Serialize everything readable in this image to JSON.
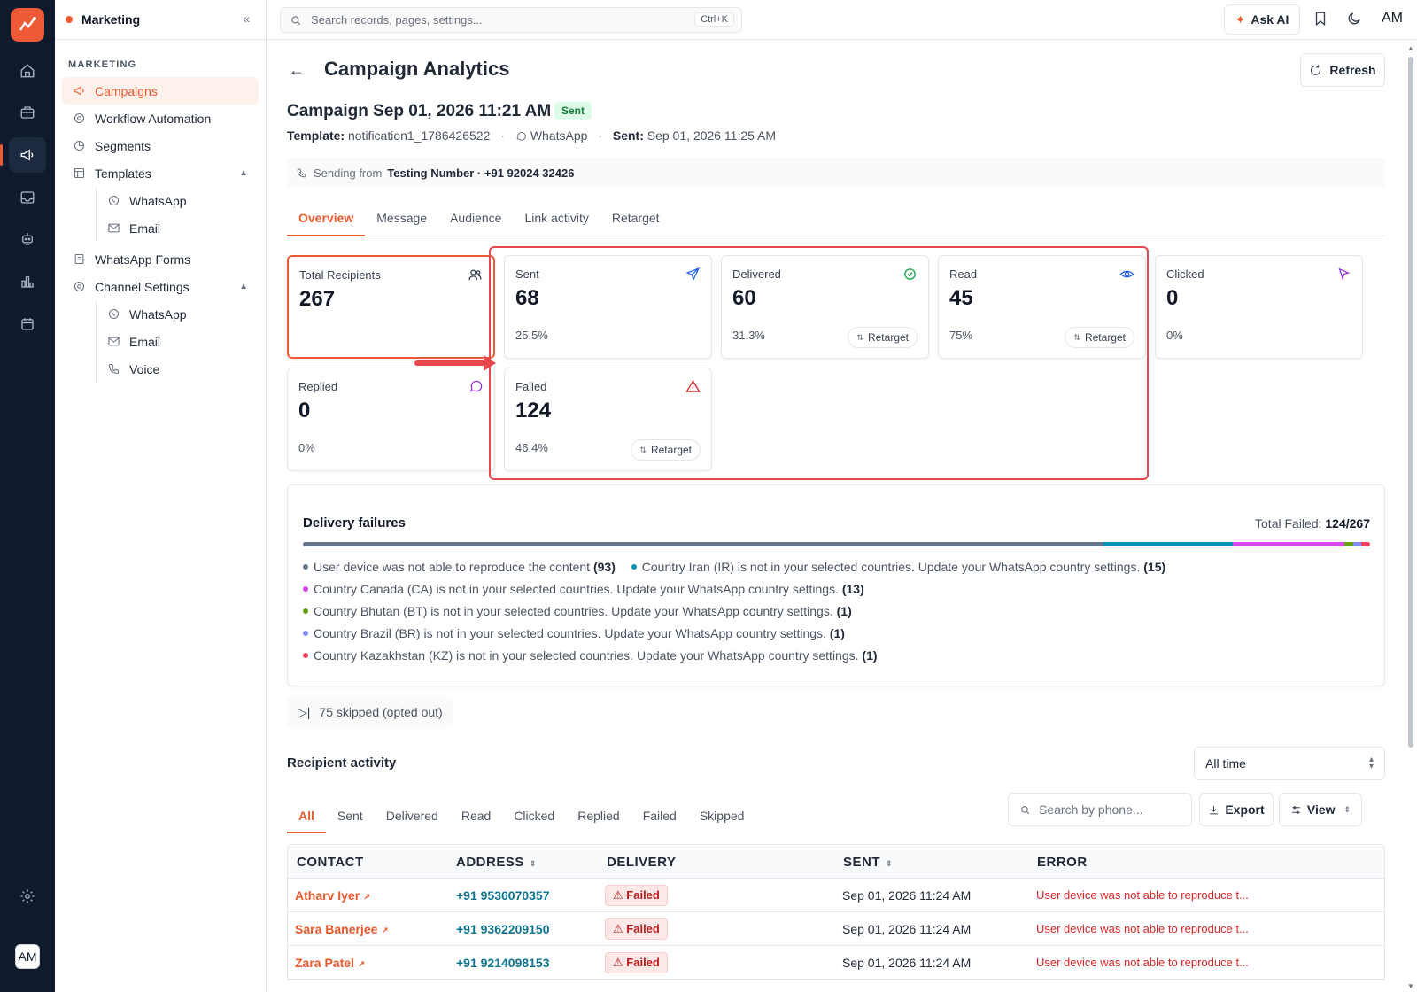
{
  "rail": {
    "logo_text": "",
    "icons": [
      "home-icon",
      "briefcase-icon",
      "megaphone-icon",
      "inbox-icon",
      "robot-icon",
      "bar-chart-icon",
      "calendar-icon"
    ],
    "settings_icon": "gear-icon",
    "avatar": "AM"
  },
  "sidebar": {
    "title": "Marketing",
    "collapse_icon": "«",
    "section": "MARKETING",
    "items": [
      {
        "label": "Campaigns",
        "icon": "megaphone-icon",
        "active": true
      },
      {
        "label": "Workflow Automation",
        "icon": "gear-icon"
      },
      {
        "label": "Segments",
        "icon": "pie-chart-icon"
      },
      {
        "label": "Templates",
        "icon": "template-icon",
        "expanded": true
      },
      {
        "label": "WhatsApp Forms",
        "icon": "form-icon"
      },
      {
        "label": "Channel Settings",
        "icon": "gear-icon",
        "expanded": true
      }
    ],
    "template_children": [
      "WhatsApp",
      "Email"
    ],
    "channel_children": [
      "WhatsApp",
      "Email",
      "Voice"
    ]
  },
  "topbar": {
    "search_placeholder": "Search records, pages, settings...",
    "shortcut": "Ctrl+K",
    "ask_ai": "Ask AI",
    "avatar": "AM"
  },
  "page": {
    "title": "Campaign Analytics",
    "refresh": "Refresh",
    "campaign_title": "Campaign Sep 01, 2026 11:21 AM",
    "status": "Sent",
    "template_label": "Template:",
    "template_value": "notification1_1786426522",
    "channel": "WhatsApp",
    "sent_label": "Sent:",
    "sent_value": "Sep 01, 2026 11:25 AM",
    "sending_from_label": "Sending from",
    "sending_from_value": "Testing Number · +91 92024 32426",
    "tabs": [
      "Overview",
      "Message",
      "Audience",
      "Link activity",
      "Retarget"
    ]
  },
  "stats": {
    "total": {
      "label": "Total Recipients",
      "value": "267"
    },
    "sent": {
      "label": "Sent",
      "value": "68",
      "pct": "25.5%"
    },
    "delivered": {
      "label": "Delivered",
      "value": "60",
      "pct": "31.3%",
      "action": "Retarget"
    },
    "read": {
      "label": "Read",
      "value": "45",
      "pct": "75%",
      "action": "Retarget"
    },
    "clicked": {
      "label": "Clicked",
      "value": "0",
      "pct": "0%"
    },
    "replied": {
      "label": "Replied",
      "value": "0",
      "pct": "0%"
    },
    "failed": {
      "label": "Failed",
      "value": "124",
      "pct": "46.4%",
      "action": "Retarget"
    }
  },
  "failures": {
    "title": "Delivery failures",
    "total_label": "Total Failed:",
    "total_value": "124/267",
    "items": [
      {
        "text": "User device was not able to reproduce the content",
        "count": "(93)",
        "value": 93,
        "color": "#64748b"
      },
      {
        "text": "Country Iran (IR) is not in your selected countries. Update your WhatsApp country settings.",
        "count": "(15)",
        "value": 15,
        "color": "#0891b2"
      },
      {
        "text": "Country Canada (CA) is not in your selected countries. Update your WhatsApp country settings.",
        "count": "(13)",
        "value": 13,
        "color": "#d946ef"
      },
      {
        "text": "Country Bhutan (BT) is not in your selected countries. Update your WhatsApp country settings.",
        "count": "(1)",
        "value": 1,
        "color": "#65a30d"
      },
      {
        "text": "Country Brazil (BR) is not in your selected countries. Update your WhatsApp country settings.",
        "count": "(1)",
        "value": 1,
        "color": "#818cf8"
      },
      {
        "text": "Country Kazakhstan (KZ) is not in your selected countries. Update your WhatsApp country settings.",
        "count": "(1)",
        "value": 1,
        "color": "#f43f5e"
      }
    ]
  },
  "skipped": "75 skipped (opted out)",
  "activity": {
    "title": "Recipient activity",
    "range": "All time",
    "tabs": [
      "All",
      "Sent",
      "Delivered",
      "Read",
      "Clicked",
      "Replied",
      "Failed",
      "Skipped"
    ],
    "search_placeholder": "Search by phone...",
    "export": "Export",
    "view": "View",
    "columns": [
      "CONTACT",
      "ADDRESS",
      "DELIVERY",
      "SENT",
      "ERROR"
    ],
    "rows": [
      {
        "contact": "Atharv Iyer",
        "address": "+91 9536070357",
        "delivery": "Failed",
        "sent": "Sep 01, 2026 11:24 AM",
        "error": "User device was not able to reproduce t..."
      },
      {
        "contact": "Sara Banerjee",
        "address": "+91 9362209150",
        "delivery": "Failed",
        "sent": "Sep 01, 2026 11:24 AM",
        "error": "User device was not able to reproduce t..."
      },
      {
        "contact": "Zara Patel",
        "address": "+91 9214098153",
        "delivery": "Failed",
        "sent": "Sep 01, 2026 11:24 AM",
        "error": "User device was not able to reproduce t..."
      }
    ]
  },
  "colors": {
    "accent": "#ea5a2f",
    "highlight": "#e5484d",
    "rail": "#0f1b2d"
  }
}
